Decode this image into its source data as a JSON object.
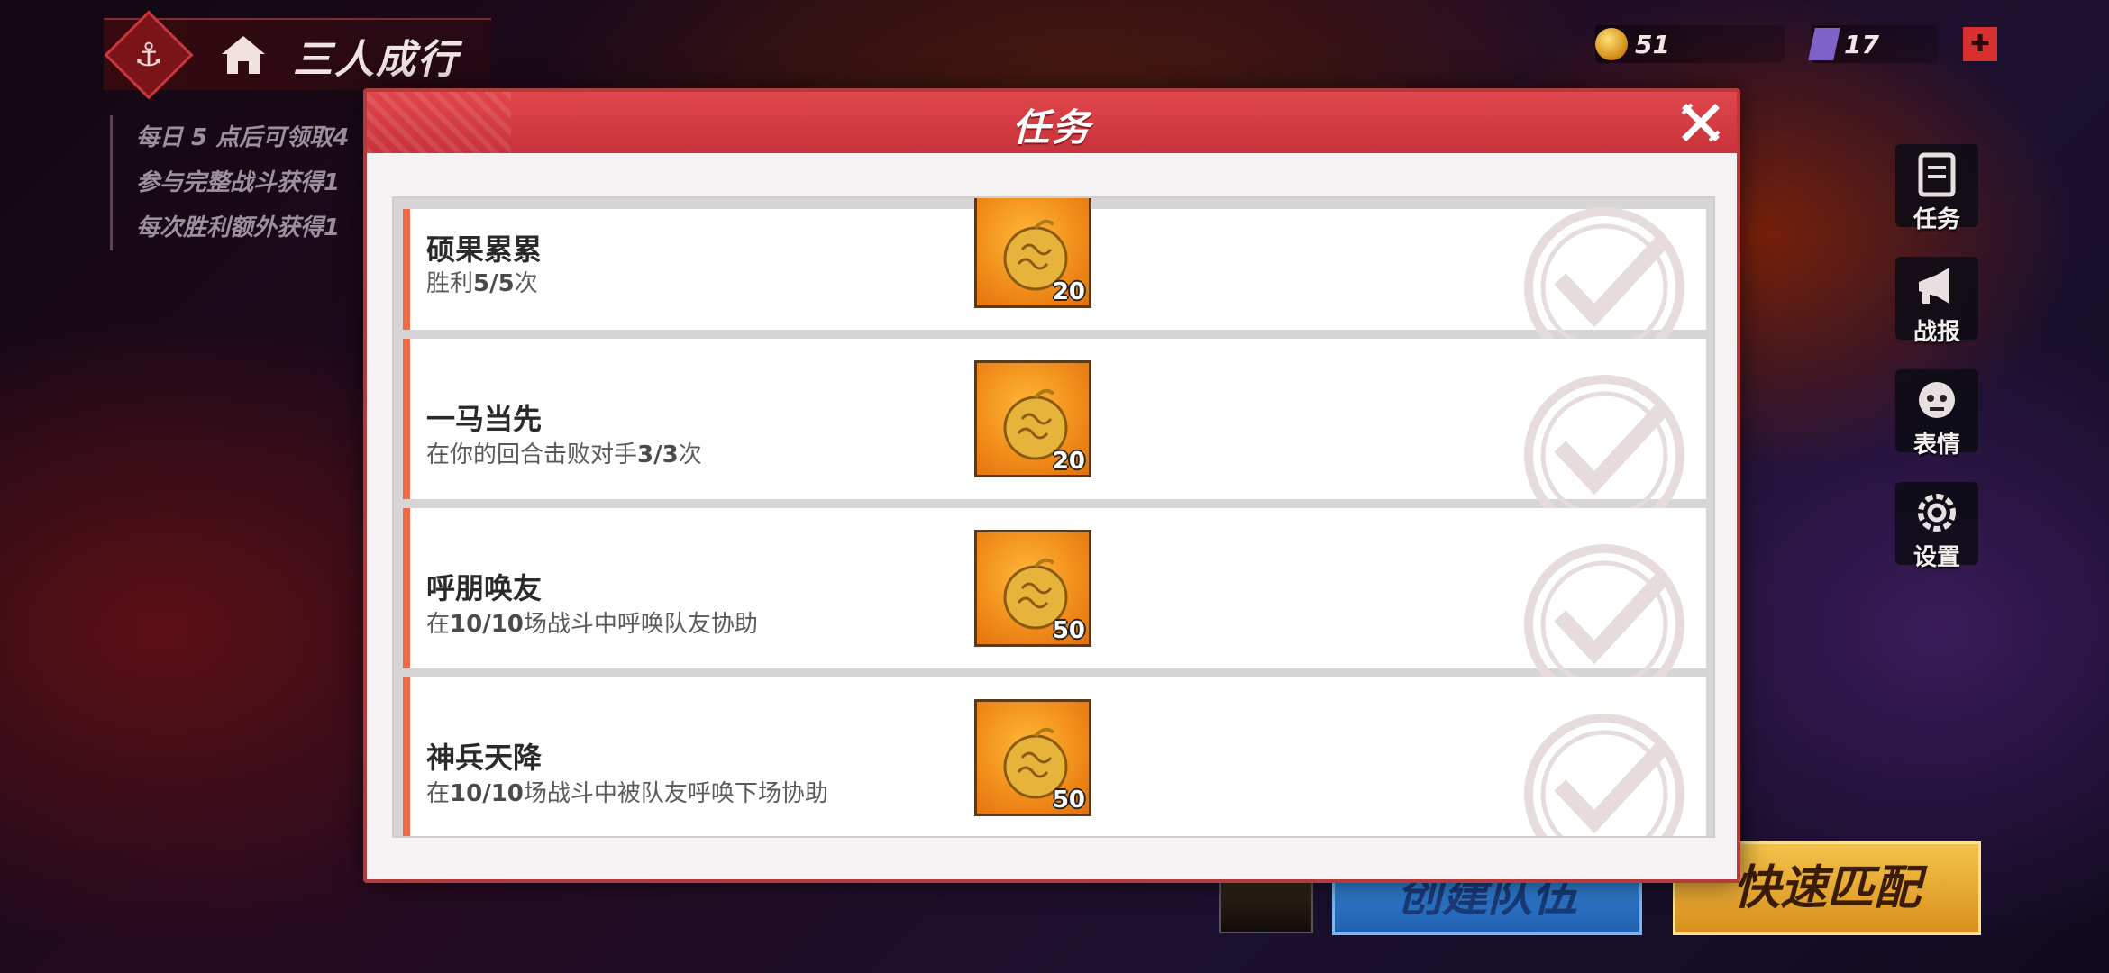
{
  "header": {
    "mode_title": "三人成行",
    "rules": [
      "每日 5 点后可领取4",
      "参与完整战斗获得1",
      "每次胜利额外获得1"
    ]
  },
  "currencies": [
    {
      "icon": "devil-fruit-icon",
      "count": "51"
    },
    {
      "icon": "gem-icon",
      "count": "17"
    }
  ],
  "side_menu": [
    {
      "label": "任务",
      "icon": "notebook-icon"
    },
    {
      "label": "战报",
      "icon": "megaphone-icon"
    },
    {
      "label": "表情",
      "icon": "emoji-skull-icon"
    },
    {
      "label": "设置",
      "icon": "gear-icon"
    }
  ],
  "bottom": {
    "create_team": "创建队伍",
    "quick_match": "快速匹配"
  },
  "modal": {
    "title": "任务",
    "tasks": [
      {
        "name": "硕果累累",
        "desc_pre": "胜利",
        "desc_bold": "5/5",
        "desc_post": "次",
        "reward_qty": "20",
        "completed": true
      },
      {
        "name": "一马当先",
        "desc_pre": "在你的回合击败对手",
        "desc_bold": "3/3",
        "desc_post": "次",
        "reward_qty": "20",
        "completed": true
      },
      {
        "name": "呼朋唤友",
        "desc_pre": "在",
        "desc_bold": "10/10",
        "desc_post": "场战斗中呼唤队友协助",
        "reward_qty": "50",
        "completed": true
      },
      {
        "name": "神兵天降",
        "desc_pre": "在",
        "desc_bold": "10/10",
        "desc_post": "场战斗中被队友呼唤下场协助",
        "reward_qty": "50",
        "completed": true
      }
    ]
  },
  "colors": {
    "modal_header": "#d23c42",
    "task_accent": "#ef6a45",
    "reward_bg": "#f08a18",
    "check_mark": "#e6dcdc"
  }
}
